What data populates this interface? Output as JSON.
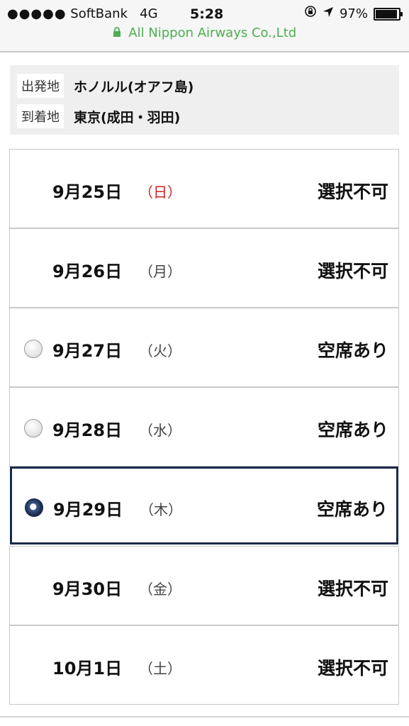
{
  "status_bar": {
    "signal_dots": "●●●●●",
    "carrier": "SoftBank",
    "network": "4G",
    "time": "5:28",
    "battery_percent": "97%",
    "icons": [
      "orientation-lock-icon",
      "location-arrow-icon",
      "battery-icon"
    ]
  },
  "url_bar": {
    "secure_icon": "lock-icon",
    "site": "All Nippon Airways Co.,Ltd",
    "accent_color": "#4caf50"
  },
  "route": {
    "origin_label": "出発地",
    "origin": "ホノルル(オアフ島)",
    "destination_label": "到着地",
    "destination": "東京(成田・羽田)"
  },
  "dates": [
    {
      "date": "9月25日",
      "dow": "（日）",
      "status": "選択不可",
      "selectable": false,
      "selected": false,
      "sunday": true
    },
    {
      "date": "9月26日",
      "dow": "（月）",
      "status": "選択不可",
      "selectable": false,
      "selected": false,
      "sunday": false
    },
    {
      "date": "9月27日",
      "dow": "（火）",
      "status": "空席あり",
      "selectable": true,
      "selected": false,
      "sunday": false
    },
    {
      "date": "9月28日",
      "dow": "（水）",
      "status": "空席あり",
      "selectable": true,
      "selected": false,
      "sunday": false
    },
    {
      "date": "9月29日",
      "dow": "（木）",
      "status": "空席あり",
      "selectable": true,
      "selected": true,
      "sunday": false
    },
    {
      "date": "9月30日",
      "dow": "（金）",
      "status": "選択不可",
      "selectable": false,
      "selected": false,
      "sunday": false
    },
    {
      "date": "10月1日",
      "dow": "（土）",
      "status": "選択不可",
      "selectable": false,
      "selected": false,
      "sunday": false
    }
  ],
  "colors": {
    "selected_border": "#1a2a4c",
    "sunday_red": "#cc2222"
  }
}
